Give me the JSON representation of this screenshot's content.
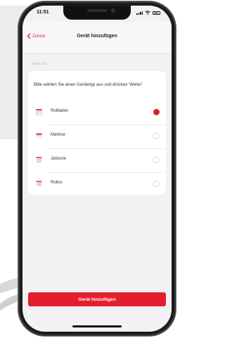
{
  "status": {
    "time": "11:51",
    "location_icon": "location-arrow-icon"
  },
  "nav": {
    "back_label": "Zurück",
    "title": "Gerät hinzufügen"
  },
  "step_label": "Schritt 2/3",
  "card": {
    "description": "Bitte wählen Sie einen Gerätetyp aus und drücken 'Weiter'",
    "options": [
      {
        "label": "Rollladen",
        "icon": "rollladen-icon",
        "selected": true
      },
      {
        "label": "Markise",
        "icon": "markise-icon",
        "selected": false
      },
      {
        "label": "Jalousie",
        "icon": "jalousie-icon",
        "selected": false
      },
      {
        "label": "Rollos",
        "icon": "rollos-icon",
        "selected": false
      }
    ]
  },
  "primary_button": {
    "label": "Gerät hinzufügen"
  },
  "colors": {
    "accent": "#e41f2d",
    "background": "#f2f2f4"
  }
}
